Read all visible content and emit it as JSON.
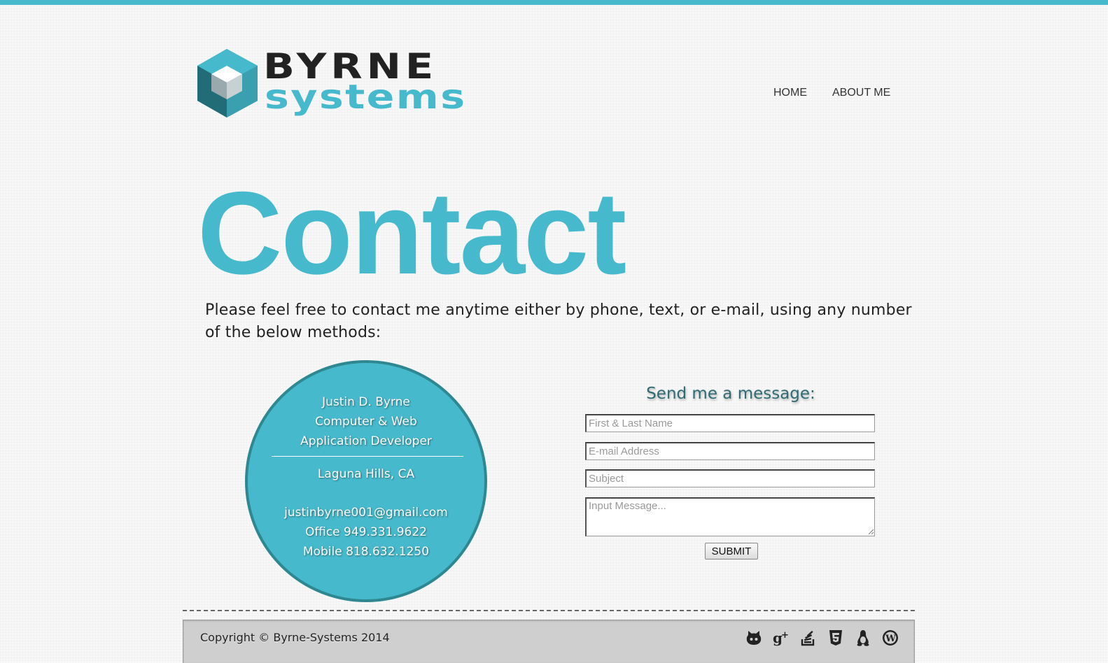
{
  "brand": {
    "line1": "BYRNE",
    "line2": "SYSTEMS",
    "accent_color": "#47b9cc",
    "dark_accent_color": "#2e8791"
  },
  "nav": {
    "items": [
      {
        "label": "HOME"
      },
      {
        "label": "ABOUT ME"
      }
    ]
  },
  "page": {
    "title": "Contact",
    "intro": "Please feel free to contact me anytime either by phone, text, or e-mail, using any number of the below methods:"
  },
  "card": {
    "name": "Justin D. Byrne",
    "role_line1": "Computer & Web",
    "role_line2": "Application Developer",
    "location": "Laguna Hills, CA",
    "email": "justinbyrne001@gmail.com",
    "office": "Office 949.331.9622",
    "mobile": "Mobile 818.632.1250"
  },
  "form": {
    "title": "Send me a message:",
    "name_placeholder": "First & Last Name",
    "email_placeholder": "E-mail Address",
    "subject_placeholder": "Subject",
    "message_placeholder": "Input Message...",
    "submit_label": "SUBMIT"
  },
  "footer": {
    "copyright": "Copyright © Byrne-Systems 2014",
    "social_icons": [
      "github-icon",
      "google-plus-icon",
      "stackoverflow-icon",
      "html5-icon",
      "linux-icon",
      "wordpress-icon"
    ]
  }
}
